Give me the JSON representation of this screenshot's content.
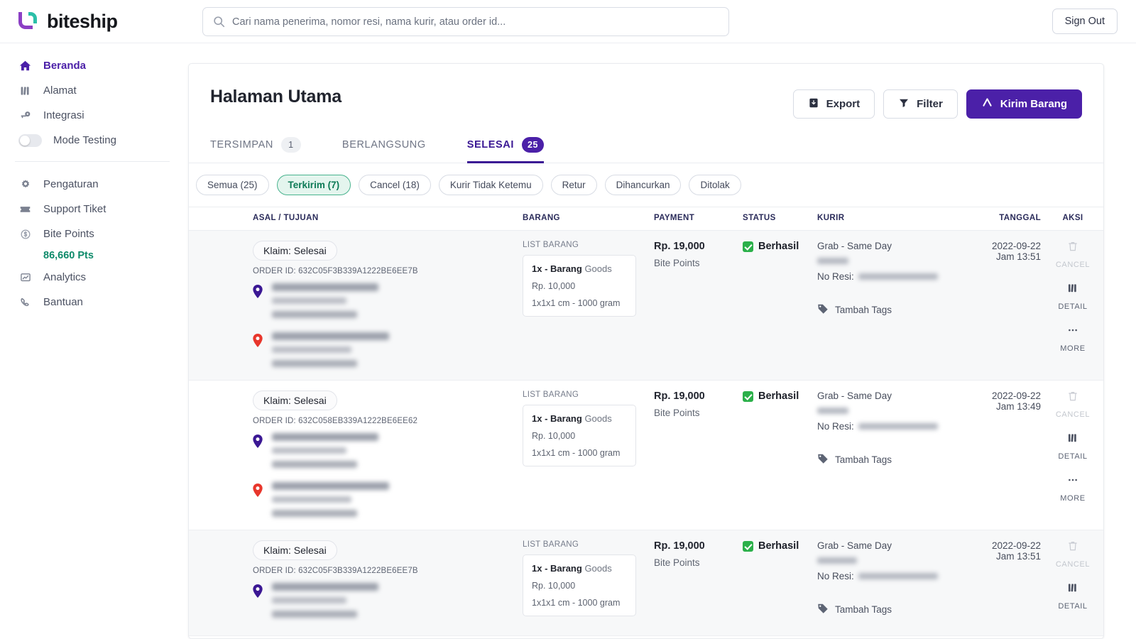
{
  "brand": {
    "name": "biteship"
  },
  "header": {
    "search_placeholder": "Cari nama penerima, nomor resi, nama kurir, atau order id...",
    "search_value": "",
    "signout_label": "Sign Out"
  },
  "sidebar": {
    "items": [
      {
        "label": "Beranda",
        "icon": "home-icon",
        "active": true
      },
      {
        "label": "Alamat",
        "icon": "book-icon",
        "active": false
      },
      {
        "label": "Integrasi",
        "icon": "key-icon",
        "active": false
      },
      {
        "label": "Mode Testing",
        "icon": "toggle-icon",
        "active": false,
        "toggle": "off"
      }
    ],
    "items2": [
      {
        "label": "Pengaturan",
        "icon": "gear-icon"
      },
      {
        "label": "Support Tiket",
        "icon": "ticket-icon"
      },
      {
        "label": "Bite Points",
        "icon": "coin-icon"
      },
      {
        "label": "Analytics",
        "icon": "chart-icon"
      },
      {
        "label": "Bantuan",
        "icon": "phone-icon"
      }
    ],
    "points_value": "86,660 Pts"
  },
  "main": {
    "page_title": "Halaman Utama",
    "buttons": {
      "export_label": "Export",
      "filter_label": "Filter",
      "kirim_label": "Kirim Barang"
    },
    "tabs": [
      {
        "label": "TERSIMPAN",
        "count": "1",
        "active": false
      },
      {
        "label": "BERLANGSUNG",
        "count": "",
        "active": false
      },
      {
        "label": "SELESAI",
        "count": "25",
        "active": true
      }
    ],
    "chips": [
      {
        "label": "Semua (25)",
        "selected": false
      },
      {
        "label": "Terkirim (7)",
        "selected": true
      },
      {
        "label": "Cancel (18)",
        "selected": false
      },
      {
        "label": "Kurir Tidak Ketemu",
        "selected": false
      },
      {
        "label": "Retur",
        "selected": false
      },
      {
        "label": "Dihancurkan",
        "selected": false
      },
      {
        "label": "Ditolak",
        "selected": false
      }
    ],
    "table": {
      "columns": [
        "ASAL / TUJUAN",
        "BARANG",
        "PAYMENT",
        "STATUS",
        "KURIR",
        "TANGGAL",
        "AKSI"
      ],
      "labels": {
        "klaim": "Klaim: Selesai",
        "order_id_prefix": "ORDER ID:",
        "list_barang": "LIST BARANG",
        "no_resi_prefix": "No Resi:",
        "tambah_tags": "Tambah Tags",
        "action_cancel": "CANCEL",
        "action_detail": "DETAIL",
        "action_more": "MORE"
      },
      "rows": [
        {
          "klaim": "Klaim: Selesai",
          "order_id": "632C05F3B339A1222BE6EE7B",
          "origin_redacted": true,
          "destination_redacted": true,
          "goods_qty": "1x - Barang",
          "goods_type": "Goods",
          "goods_price": "Rp. 10,000",
          "goods_dims": "1x1x1 cm - 1000 gram",
          "payment_amount": "Rp. 19,000",
          "payment_method": "Bite Points",
          "status": "Berhasil",
          "courier": "Grab - Same Day",
          "courier_name_redacted": true,
          "resi_redacted": true,
          "date": "2022-09-22",
          "time": "Jam 13:51"
        },
        {
          "klaim": "Klaim: Selesai",
          "order_id": "632C058EB339A1222BE6EE62",
          "origin_redacted": true,
          "destination_redacted": true,
          "goods_qty": "1x - Barang",
          "goods_type": "Goods",
          "goods_price": "Rp. 10,000",
          "goods_dims": "1x1x1 cm - 1000 gram",
          "payment_amount": "Rp. 19,000",
          "payment_method": "Bite Points",
          "status": "Berhasil",
          "courier": "Grab - Same Day",
          "courier_name_redacted": true,
          "resi_redacted": true,
          "date": "2022-09-22",
          "time": "Jam 13:49"
        },
        {
          "klaim": "Klaim: Selesai",
          "order_id": "632C05F3B339A1222BE6EE7B",
          "origin_redacted": true,
          "destination_redacted": true,
          "goods_qty": "1x - Barang",
          "goods_type": "Goods",
          "goods_price": "Rp. 10,000",
          "goods_dims": "1x1x1 cm - 1000 gram",
          "payment_amount": "Rp. 19,000",
          "payment_method": "Bite Points",
          "status": "Berhasil",
          "courier": "Grab - Same Day",
          "courier_name_redacted": true,
          "resi_redacted": true,
          "date": "2022-09-22",
          "time": "Jam 13:51"
        }
      ]
    }
  },
  "colors": {
    "brand_purple": "#4b20a8",
    "brand_teal": "#2bbfa8",
    "accent_green": "#0d7a56",
    "status_green": "#2bb04a",
    "origin_pin": "#3b1894",
    "dest_pin": "#e8362c"
  }
}
